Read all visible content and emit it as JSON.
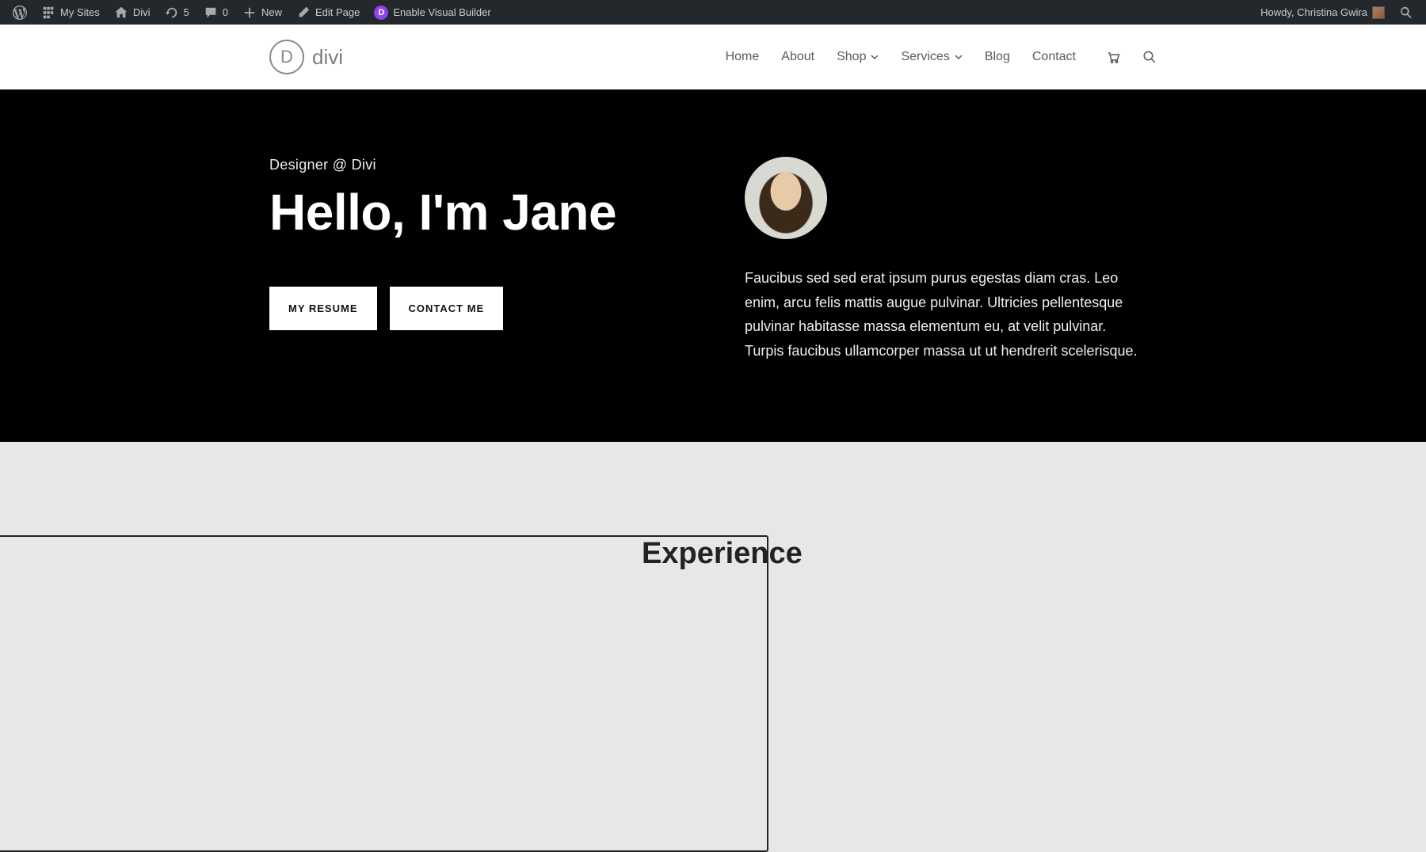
{
  "admin_bar": {
    "my_sites": "My Sites",
    "site_name": "Divi",
    "updates": "5",
    "comments": "0",
    "new": "New",
    "edit_page": "Edit Page",
    "visual_builder": "Enable Visual Builder",
    "howdy": "Howdy, Christina Gwira"
  },
  "nav": {
    "logo_text": "divi",
    "items": {
      "home": "Home",
      "about": "About",
      "shop": "Shop",
      "services": "Services",
      "blog": "Blog",
      "contact": "Contact"
    }
  },
  "hero": {
    "pre": "Designer @ Divi",
    "title": "Hello, I'm Jane",
    "resume_btn": "MY RESUME",
    "contact_btn": "CONTACT ME",
    "bio": "Faucibus sed sed erat ipsum purus egestas diam cras. Leo enim, arcu felis mattis augue pulvinar. Ultricies pellentesque pulvinar habitasse massa elementum eu, at velit pulvinar. Turpis faucibus ullamcorper massa ut ut hendrerit scelerisque."
  },
  "experience": {
    "title": "Experience"
  }
}
